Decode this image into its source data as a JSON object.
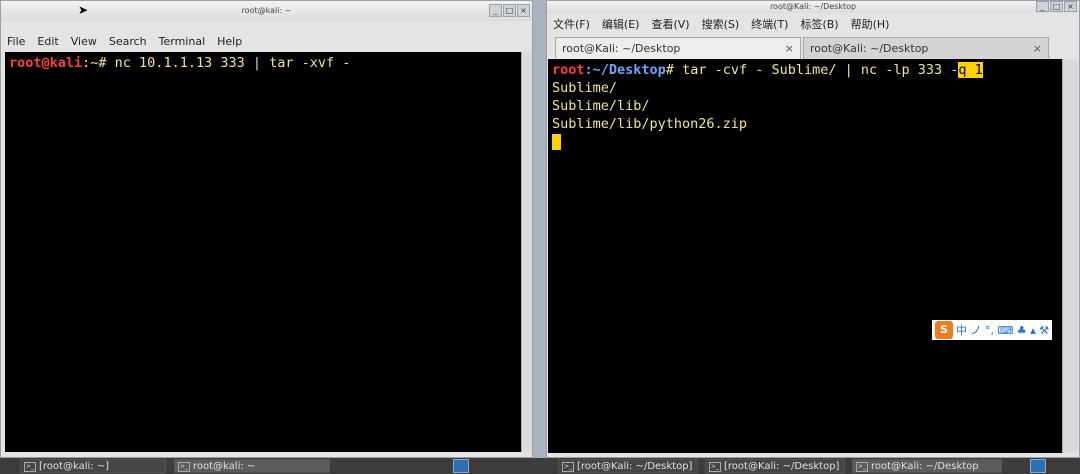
{
  "left_window": {
    "title": "root@kali: ~",
    "menu": [
      "File",
      "Edit",
      "View",
      "Search",
      "Terminal",
      "Help"
    ],
    "prompt_user": "root@kali",
    "prompt_sep": ":~# ",
    "command": "nc 10.1.1.13 333 | tar -xvf -"
  },
  "right_window": {
    "title": "root@Kali: ~/Desktop",
    "menu": [
      "文件(F)",
      "编辑(E)",
      "查看(V)",
      "搜索(S)",
      "终端(T)",
      "标签(B)",
      "帮助(H)"
    ],
    "tabs": [
      {
        "label": "root@Kali: ~/Desktop",
        "close": "×"
      },
      {
        "label": "root@Kali: ~/Desktop",
        "close": "×"
      }
    ],
    "prompt_user": "root",
    "prompt_path": ":~/Desktop",
    "prompt_end": "# ",
    "command_main": "tar -cvf - Sublime/ | nc -lp 333 -",
    "command_highlight": "q 1",
    "output": [
      "Sublime/",
      "Sublime/lib/",
      "Sublime/lib/python26.zip"
    ]
  },
  "ime": {
    "logo": "S",
    "text": "中 ノ °, ⌨ ♣ ▴ ⚒"
  },
  "taskbar": {
    "items": [
      "[root@kali: ~]",
      "root@kali: ~",
      "[root@Kali: ~/Desktop]",
      "[root@Kali: ~/Desktop]",
      "root@Kali: ~/Desktop"
    ]
  }
}
